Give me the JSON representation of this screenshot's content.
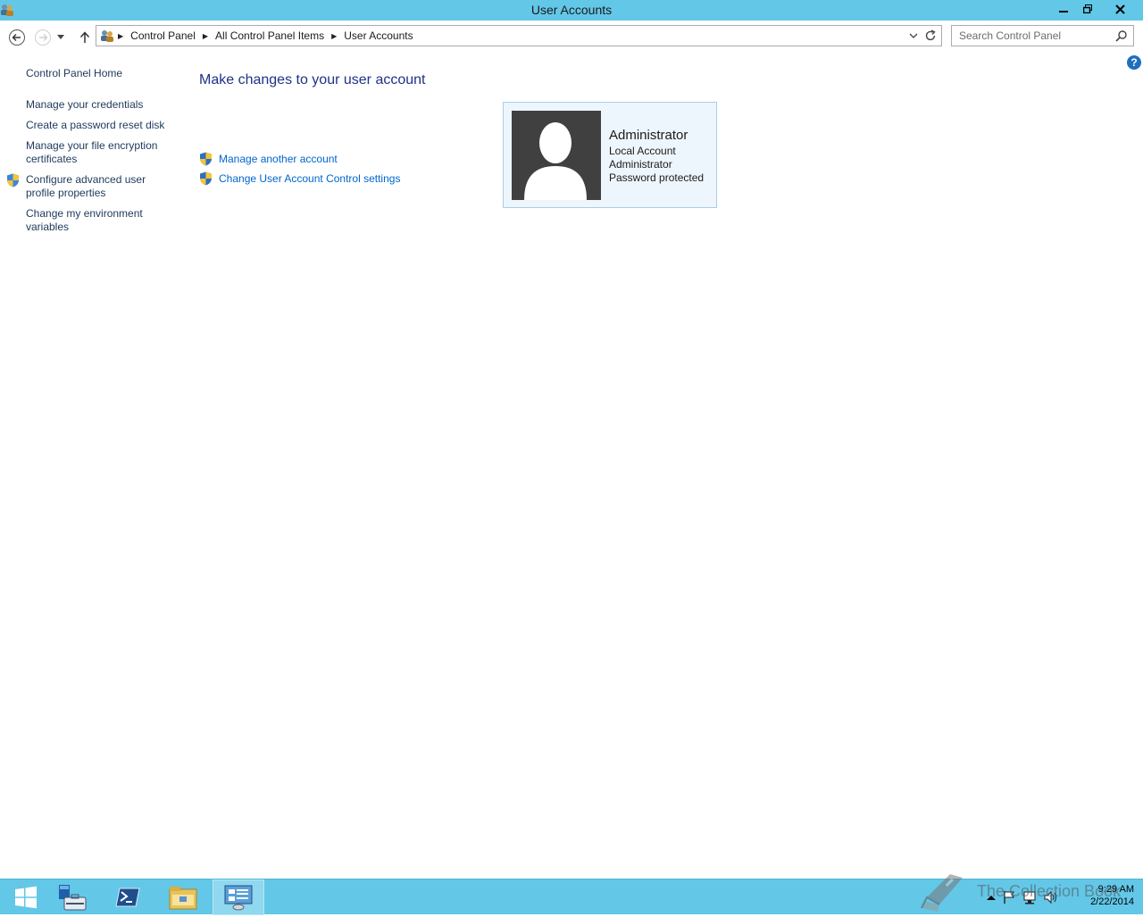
{
  "window": {
    "title": "User Accounts",
    "icons": [
      "users-app-icon",
      "minimize-icon",
      "restore-icon",
      "close-icon"
    ]
  },
  "nav": {
    "breadcrumbs": [
      "Control Panel",
      "All Control Panel Items",
      "User Accounts"
    ],
    "search_placeholder": "Search Control Panel"
  },
  "sidebar": {
    "home": "Control Panel Home",
    "items": [
      {
        "label": "Manage your credentials"
      },
      {
        "label": "Create a password reset disk"
      },
      {
        "label": "Manage your file encryption certificates"
      },
      {
        "label": "Configure advanced user profile properties",
        "icon": "uac-shield-icon"
      },
      {
        "label": "Change my environment variables"
      }
    ]
  },
  "main": {
    "title": "Make changes to your user account",
    "tasks": [
      {
        "label": "Manage another account",
        "icon": "uac-shield-icon"
      },
      {
        "label": "Change User Account Control settings",
        "icon": "uac-shield-icon"
      }
    ]
  },
  "account": {
    "name": "Administrator",
    "details": [
      "Local Account",
      "Administrator",
      "Password protected"
    ]
  },
  "taskbar": {
    "items": [
      "start-icon",
      "server-manager-icon",
      "powershell-icon",
      "file-explorer-icon",
      "control-panel-icon"
    ],
    "clock_time": "9:29 AM",
    "clock_date": "2/22/2014",
    "watermark": "The Collection Book"
  },
  "colors": {
    "titlebar": "#63c7e8",
    "link": "#0066cc",
    "heading": "#1e3287",
    "card_bg": "#eef6fd"
  }
}
